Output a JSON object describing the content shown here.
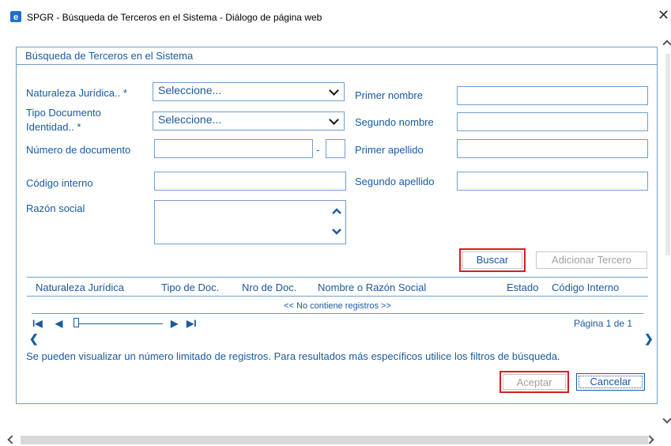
{
  "window": {
    "title": "SPGR - Búsqueda de Terceros en el Sistema - Diálogo de página web",
    "close_glyph": "✕"
  },
  "panel": {
    "title": "Búsqueda de Terceros en el Sistema"
  },
  "form": {
    "naturaleza_label": "Naturaleza Jurídica.. *",
    "naturaleza_value": "Seleccione...",
    "tipo_doc_label_1": "Tipo Documento",
    "tipo_doc_label_2": "Identidad.. *",
    "tipo_doc_value": "Seleccione...",
    "numero_doc_label": "Número de documento",
    "numero_doc_value": "",
    "dash": "-",
    "dv_value": "",
    "codigo_label": "Código interno",
    "codigo_value": "",
    "razon_label": "Razón social",
    "razon_value": "",
    "primer_nombre_label": "Primer nombre",
    "primer_nombre_value": "",
    "segundo_nombre_label": "Segundo nombre",
    "segundo_nombre_value": "",
    "primer_apellido_label": "Primer apellido",
    "primer_apellido_value": "",
    "segundo_apellido_label": "Segundo apellido",
    "segundo_apellido_value": ""
  },
  "actions": {
    "buscar": "Buscar",
    "adicionar": "Adicionar Tercero"
  },
  "table": {
    "columns": [
      "Naturaleza Jurídica",
      "Tipo de Doc.",
      "Nro de Doc.",
      "Nombre o Razón Social",
      "Estado",
      "Código Interno"
    ],
    "empty_message": "<< No contiene registros >>",
    "pager_first": "I◀",
    "pager_prev": "◀",
    "pager_next": "▶",
    "pager_last": "▶I",
    "page_label": "Página 1 de 1",
    "scroll_left": "❮",
    "scroll_right": "❯"
  },
  "note": "Se pueden visualizar un número limitado de registros. Para resultados más específicos utilice los filtros de búsqueda.",
  "footer": {
    "aceptar": "Aceptar",
    "cancelar": "Cancelar"
  },
  "colors": {
    "accent": "#1a5aa0",
    "border": "#6f9fd0",
    "highlight": "#d62020"
  }
}
